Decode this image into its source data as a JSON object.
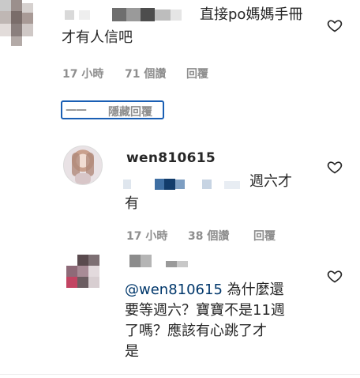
{
  "comments": [
    {
      "avatar": "blurred",
      "username": "",
      "text_line1": "直接po媽媽手冊",
      "text_line2": "才有人信吧",
      "time": "17 小時",
      "likes": "71 個讚",
      "reply": "回覆",
      "like_icon": "heart-outline"
    },
    {
      "avatar": "profile-photo",
      "username": "wen810615",
      "text_line1": "週六才",
      "text_line2": "有",
      "time": "17 小時",
      "likes": "38 個讚",
      "reply": "回覆",
      "like_icon": "heart-outline"
    },
    {
      "avatar": "blurred",
      "username": "",
      "mention": "@wen810615",
      "text_line1_rest": " 為什麼還",
      "text_line2": "要等週六？寶寶不是11週",
      "text_line3": "了嗎？應該有心跳了才",
      "text_line4": "是",
      "like_icon": "heart-outline"
    }
  ],
  "hide_replies": {
    "dash": "——",
    "label": "隱藏回覆"
  },
  "colors": {
    "text": "#262626",
    "meta": "#8e8e8e",
    "mention": "#00376b",
    "focus": "#1a5fb4"
  }
}
